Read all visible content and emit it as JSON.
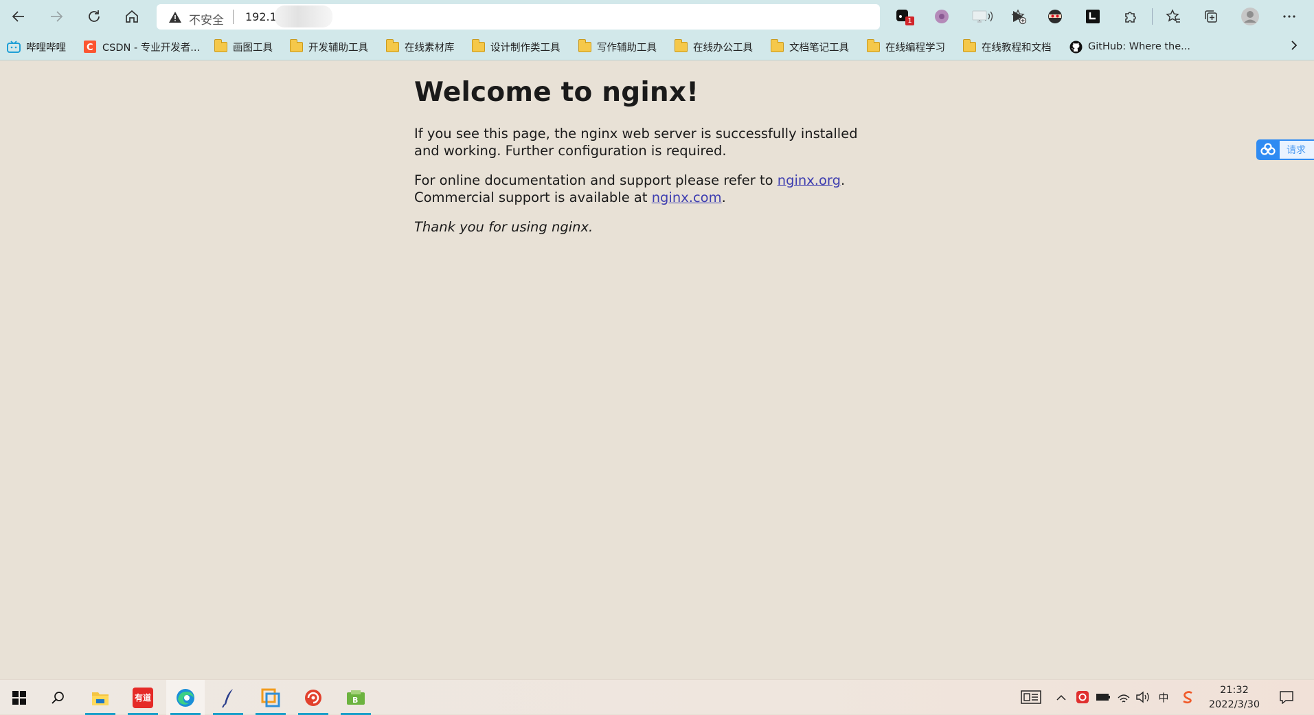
{
  "browser": {
    "address_bar": {
      "security_label": "不安全",
      "url": "192.16"
    }
  },
  "bookmarks": [
    {
      "label": "哔哩哔哩",
      "icon": "bilibili-icon"
    },
    {
      "label": "CSDN - 专业开发者...",
      "icon": "csdn-icon"
    },
    {
      "label": "画图工具",
      "icon": "folder-icon"
    },
    {
      "label": "开发辅助工具",
      "icon": "folder-icon"
    },
    {
      "label": "在线素材库",
      "icon": "folder-icon"
    },
    {
      "label": "设计制作类工具",
      "icon": "folder-icon"
    },
    {
      "label": "写作辅助工具",
      "icon": "folder-icon"
    },
    {
      "label": "在线办公工具",
      "icon": "folder-icon"
    },
    {
      "label": "文档笔记工具",
      "icon": "folder-icon"
    },
    {
      "label": "在线编程学习",
      "icon": "folder-icon"
    },
    {
      "label": "在线教程和文档",
      "icon": "folder-icon"
    },
    {
      "label": "GitHub: Where the...",
      "icon": "github-icon"
    }
  ],
  "page": {
    "title": "Welcome to nginx!",
    "para1": "If you see this page, the nginx web server is successfully installed and working. Further configuration is required.",
    "para2_prefix": "For online documentation and support please refer to ",
    "link_org": "nginx.org",
    "para2_mid": ".",
    "para2_line2": "Commercial support is available at ",
    "link_com": "nginx.com",
    "para2_suffix": ".",
    "thanks": "Thank you for using nginx."
  },
  "side_widget": {
    "label": "请求"
  },
  "extensions": {
    "badge_count": "1"
  },
  "taskbar": {
    "clock_time": "21:32",
    "clock_date": "2022/3/30",
    "ime": "中",
    "youdao_label": "有道"
  },
  "colors": {
    "toolbar_bg": "#d2e8ea",
    "page_bg": "#e8e1d6",
    "link": "#3e3eb0",
    "taskbar_accent": "#1a9fc9"
  }
}
